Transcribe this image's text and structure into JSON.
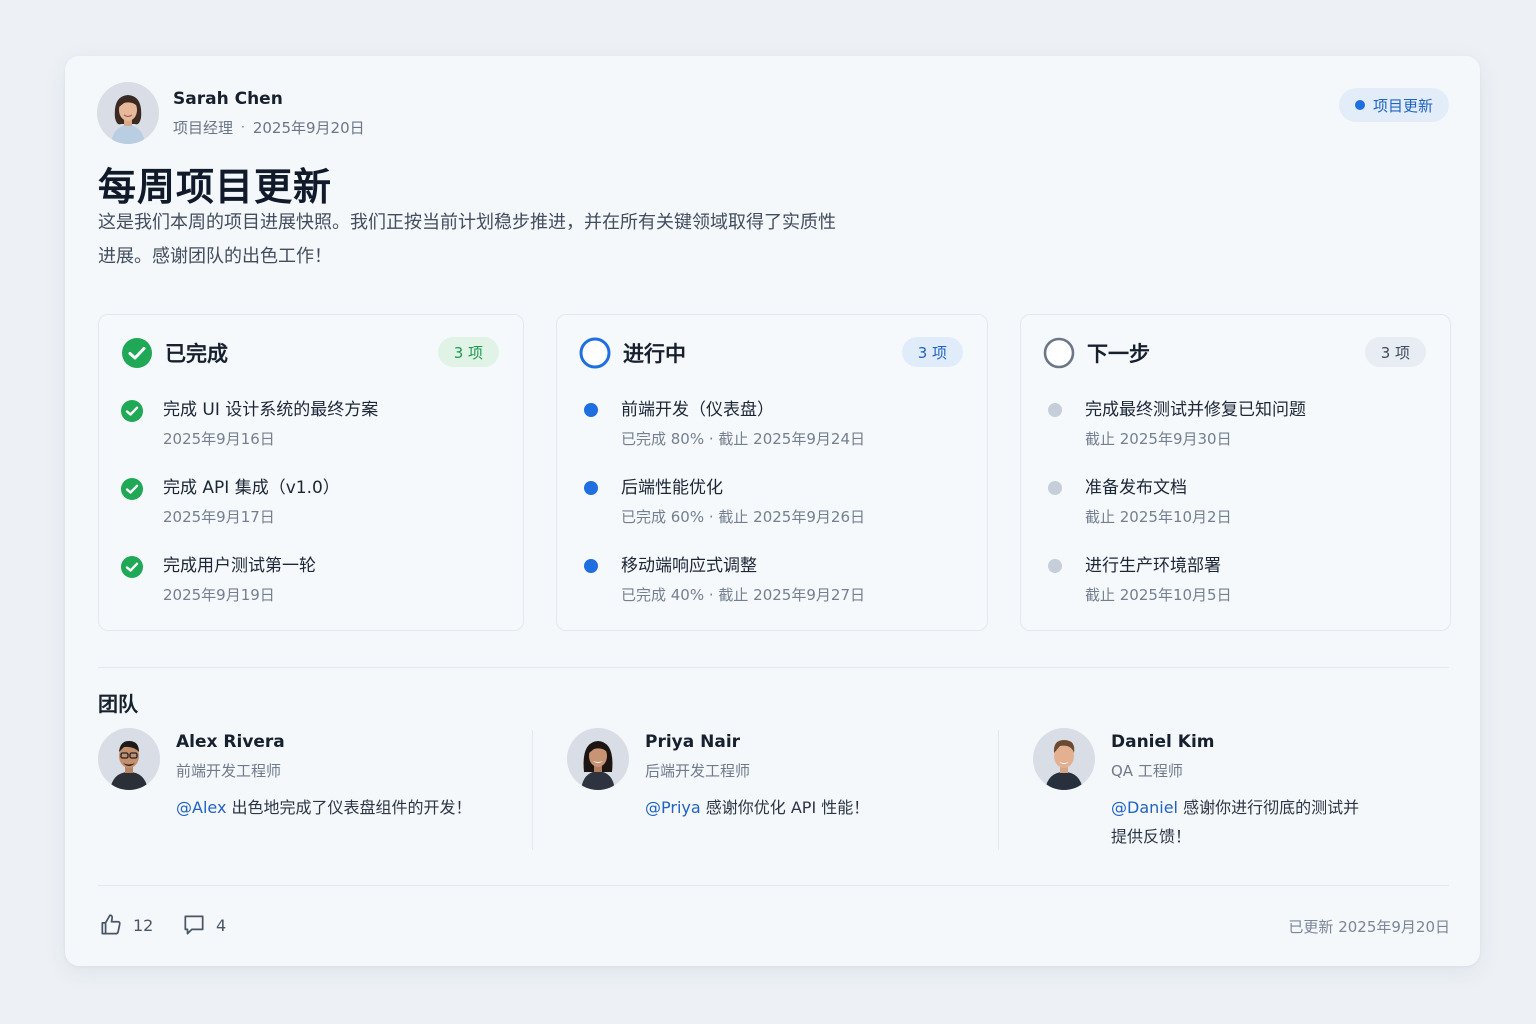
{
  "author": {
    "name": "Sarah Chen",
    "role": "项目经理",
    "separator": "·",
    "date": "2025年9月20日",
    "avatar_icon": "person-avatar-woman"
  },
  "tag": {
    "label": "项目更新",
    "color": "#1f6fe0"
  },
  "title": "每周项目更新",
  "description": "这是我们本周的项目进展快照。我们正按当前计划稳步推进，并在所有关键领域取得了实质性进展。感谢团队的出色工作！",
  "columns": {
    "done": {
      "title": "已完成",
      "count": "3 项",
      "color": "#1fa855",
      "icon": "check-circle-icon",
      "items": [
        {
          "title": "完成 UI 设计系统的最终方案",
          "sub": "2025年9月16日"
        },
        {
          "title": "完成 API 集成（v1.0）",
          "sub": "2025年9月17日"
        },
        {
          "title": "完成用户测试第一轮",
          "sub": "2025年9月19日"
        }
      ]
    },
    "progress": {
      "title": "进行中",
      "count": "3 项",
      "color": "#1f6fe0",
      "icon": "progress-circle-icon",
      "items": [
        {
          "title": "前端开发（仪表盘）",
          "sub": "已完成 80% · 截止 2025年9月24日"
        },
        {
          "title": "后端性能优化",
          "sub": "已完成 60% · 截止 2025年9月26日"
        },
        {
          "title": "移动端响应式调整",
          "sub": "已完成 40% · 截止 2025年9月27日"
        }
      ]
    },
    "next": {
      "title": "下一步",
      "count": "3 项",
      "color": "#6b7789",
      "icon": "empty-circle-icon",
      "items": [
        {
          "title": "完成最终测试并修复已知问题",
          "sub": "截止 2025年9月30日"
        },
        {
          "title": "准备发布文档",
          "sub": "截止 2025年10月2日"
        },
        {
          "title": "进行生产环境部署",
          "sub": "截止 2025年10月5日"
        }
      ]
    }
  },
  "team": {
    "title": "团队",
    "members": [
      {
        "name": "Alex Rivera",
        "role": "前端开发工程师",
        "mention": "@Alex",
        "note": "出色地完成了仪表盘组件的开发！"
      },
      {
        "name": "Priya Nair",
        "role": "后端开发工程师",
        "mention": "@Priya",
        "note": "感谢你优化 API 性能！"
      },
      {
        "name": "Daniel Kim",
        "role": "QA 工程师",
        "mention": "@Daniel",
        "note": "感谢你进行彻底的测试并提供反馈！"
      }
    ]
  },
  "footer": {
    "likes": "12",
    "comments": "4",
    "updated": "已更新 2025年9月20日",
    "like_icon": "thumbs-up-icon",
    "comment_icon": "comment-icon"
  }
}
